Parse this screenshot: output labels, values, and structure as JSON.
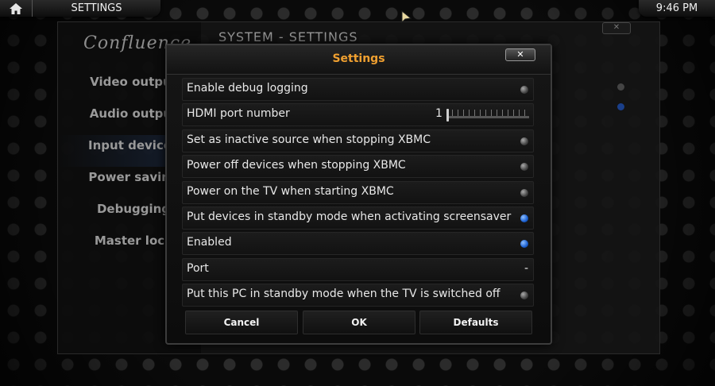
{
  "topbar": {
    "title": "SETTINGS",
    "time": "9:46 PM"
  },
  "background_window": {
    "logo": "Confluence",
    "title": "SYSTEM - SETTINGS",
    "close_label": "✕",
    "menu": [
      {
        "label": "Video output"
      },
      {
        "label": "Audio output"
      },
      {
        "label": "Input devices"
      },
      {
        "label": "Power saving"
      },
      {
        "label": "Debugging"
      },
      {
        "label": "Master lock"
      }
    ]
  },
  "dialog": {
    "title": "Settings",
    "close_label": "✕",
    "rows": [
      {
        "label": "Enable debug logging",
        "type": "radio",
        "checked": false
      },
      {
        "label": "HDMI port number",
        "type": "slider",
        "value": "1"
      },
      {
        "label": "Set as inactive source when stopping XBMC",
        "type": "radio",
        "checked": false
      },
      {
        "label": "Power off devices when stopping XBMC",
        "type": "radio",
        "checked": false
      },
      {
        "label": "Power on the TV when starting XBMC",
        "type": "radio",
        "checked": false
      },
      {
        "label": "Put devices in standby mode when activating screensaver",
        "type": "radio",
        "checked": true
      },
      {
        "label": "Enabled",
        "type": "radio",
        "checked": true
      },
      {
        "label": "Port",
        "type": "value",
        "value": "-"
      },
      {
        "label": "Put this PC in standby mode when the TV is switched off",
        "type": "radio",
        "checked": false
      }
    ],
    "buttons": {
      "cancel": "Cancel",
      "ok": "OK",
      "defaults": "Defaults"
    }
  },
  "colors": {
    "title_accent": "#f0a030",
    "radio_on": "#1a5fd0"
  }
}
